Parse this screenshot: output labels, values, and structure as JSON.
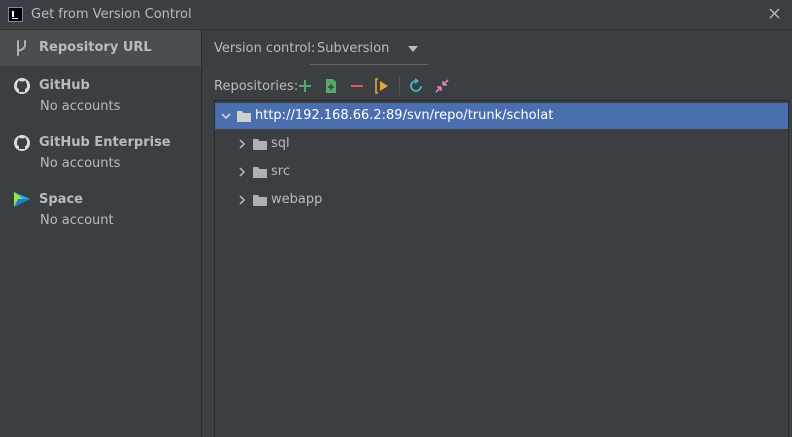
{
  "window": {
    "title": "Get from Version Control"
  },
  "sidebar": {
    "items": [
      {
        "label": "Repository URL",
        "sub": "",
        "icon": "vcs-branch-icon"
      },
      {
        "label": "GitHub",
        "sub": "No accounts",
        "icon": "github-icon"
      },
      {
        "label": "GitHub Enterprise",
        "sub": "No accounts",
        "icon": "github-icon"
      },
      {
        "label": "Space",
        "sub": "No account",
        "icon": "space-icon"
      }
    ]
  },
  "main": {
    "version_control_label": "Version control:",
    "version_control_value": "Subversion",
    "repositories_label": "Repositories:",
    "toolbar": [
      "add-icon",
      "add-repository-icon",
      "remove-icon",
      "branch-icon",
      "refresh-icon",
      "collapse-icon"
    ],
    "tree": {
      "root": "http://192.168.66.2:89/svn/repo/trunk/scholat",
      "children": [
        "sql",
        "src",
        "webapp"
      ]
    }
  },
  "colors": {
    "background": "#3c3f41",
    "selection": "#4b6eaf",
    "sidebar_selected": "#4b4e51",
    "add_green": "#59a869",
    "remove_red": "#db5c5c",
    "branch_orange": "#e8a33d",
    "refresh_teal": "#3fb7c4",
    "collapse_pink": "#d989c2"
  }
}
